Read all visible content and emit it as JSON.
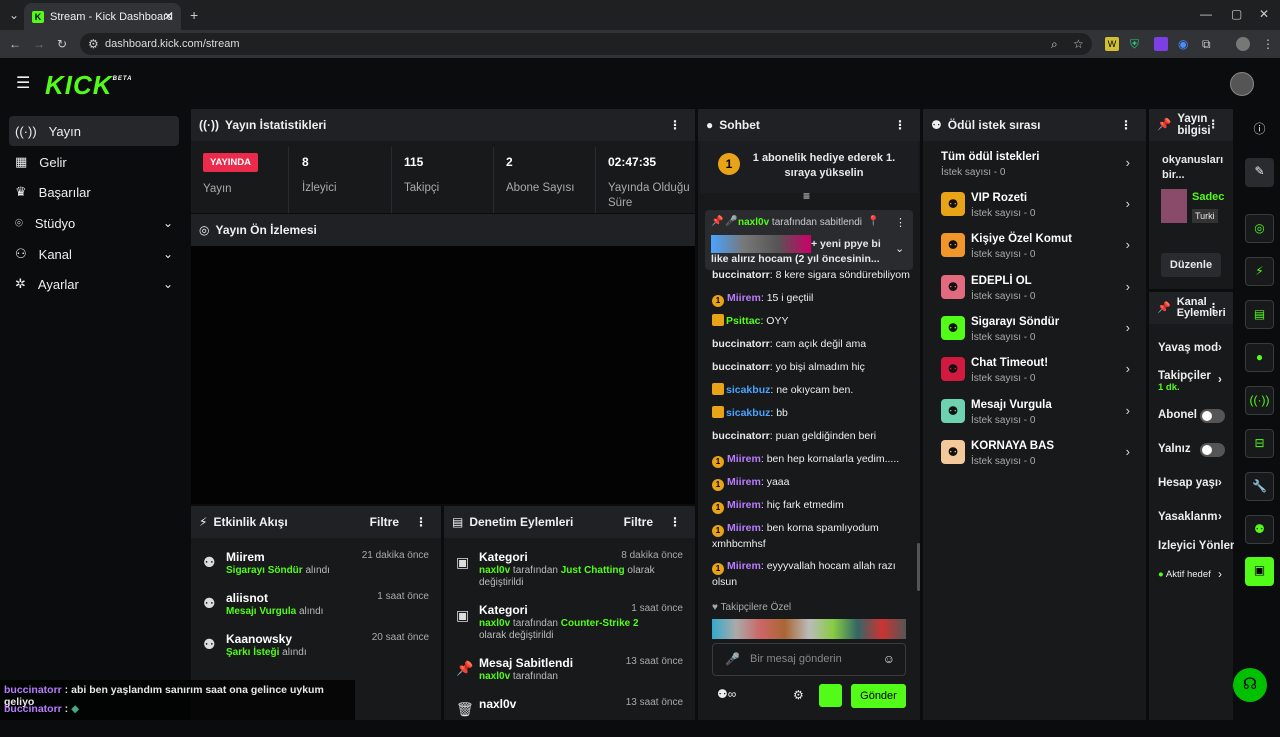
{
  "browser": {
    "tab_title": "Stream - Kick Dashboard",
    "url": "dashboard.kick.com/stream"
  },
  "brand": {
    "logo": "KICK",
    "logo_sup": "BETA"
  },
  "nav": [
    {
      "label": "Yayın",
      "icon": "broadcast-icon"
    },
    {
      "label": "Gelir",
      "icon": "chart-icon"
    },
    {
      "label": "Başarılar",
      "icon": "trophy-icon"
    },
    {
      "label": "Stüdyo",
      "icon": "studio-icon"
    },
    {
      "label": "Kanal",
      "icon": "users-icon"
    },
    {
      "label": "Ayarlar",
      "icon": "gear-icon"
    }
  ],
  "stats": {
    "title": "Yayın İstatistikleri",
    "live": "YAYINDA",
    "live_label": "Yayın",
    "items": [
      {
        "value": "8",
        "label": "İzleyici"
      },
      {
        "value": "115",
        "label": "Takipçi"
      },
      {
        "value": "2",
        "label": "Abone Sayısı"
      },
      {
        "value": "02:47:35",
        "label": "Yayında Olduğu Süre"
      }
    ]
  },
  "preview": {
    "title": "Yayın Ön İzlemesi"
  },
  "activity": {
    "title": "Etkinlik Akışı",
    "filter": "Filtre",
    "items": [
      {
        "name": "Miirem",
        "reward": "Sigarayı Söndür",
        "suffix": "alındı",
        "time": "21 dakika önce"
      },
      {
        "name": "aliisnot",
        "reward": "Mesajı Vurgula",
        "suffix": "alındı",
        "time": "1 saat önce"
      },
      {
        "name": "Kaanowsky",
        "reward": "Şarkı İsteği",
        "suffix": "alındı",
        "time": "20 saat önce"
      }
    ]
  },
  "moderation": {
    "title": "Denetim Eylemleri",
    "filter": "Filtre",
    "items": [
      {
        "name": "Kategori",
        "user": "naxl0v",
        "mid": "tarafından",
        "value": "Just Chatting",
        "end": "olarak değiştirildi",
        "time": "8 dakika önce"
      },
      {
        "name": "Kategori",
        "user": "naxl0v",
        "mid": "tarafından",
        "value": "Counter-Strike 2",
        "end": "olarak değiştirildi",
        "time": "1 saat önce"
      },
      {
        "name": "Mesaj Sabitlendi",
        "user": "naxl0v",
        "mid": "tarafından",
        "value": "",
        "end": "",
        "time": "13 saat önce"
      },
      {
        "name": "naxl0v",
        "user": "",
        "mid": "",
        "value": "",
        "end": "",
        "time": "13 saat önce"
      }
    ]
  },
  "chat": {
    "title": "Sohbet",
    "promo": "1 abonelik hediye ederek 1. sıraya yükselin",
    "promo_num": "1",
    "pinned_user": "naxl0v",
    "pinned_by": "tarafından sabitlendi",
    "pinned_text": "+ yeni ppye bi like alırız hocam (2 yıl öncesinin...",
    "messages": [
      {
        "user": "buccinatorr",
        "cls": "u-w",
        "text": "8 kere sigara söndürebiliyom",
        "coin": false
      },
      {
        "user": "Miirem",
        "cls": "u-p",
        "text": "15 i geçtiil",
        "coin": true
      },
      {
        "user": "Psittac",
        "cls": "u-g",
        "text": "OYY",
        "coin": false
      },
      {
        "user": "buccinatorr",
        "cls": "u-w",
        "text": "cam açık değil ama",
        "coin": false
      },
      {
        "user": "buccinatorr",
        "cls": "u-w",
        "text": "yo bişi almadım hiç",
        "coin": false
      },
      {
        "user": "sicakbuz",
        "cls": "u-b",
        "text": "ne okıycam ben.",
        "coin": false
      },
      {
        "user": "sicakbuz",
        "cls": "u-b",
        "text": "bb",
        "coin": false
      },
      {
        "user": "buccinatorr",
        "cls": "u-w",
        "text": "puan geldiğinden beri",
        "coin": false
      },
      {
        "user": "Miirem",
        "cls": "u-p",
        "text": "ben hep kornalarla yedim.....",
        "coin": true
      },
      {
        "user": "Miirem",
        "cls": "u-p",
        "text": "yaaa",
        "coin": true
      },
      {
        "user": "Miirem",
        "cls": "u-p",
        "text": "hiç fark etmedim",
        "coin": true
      },
      {
        "user": "Miirem",
        "cls": "u-p",
        "text": "ben korna spamlıyodum xmhbcmhsf",
        "coin": true
      },
      {
        "user": "Miirem",
        "cls": "u-p",
        "text": "eyyyvallah hocam allah razı olsun",
        "coin": true
      }
    ],
    "followers_only": "Takipçilere Özel",
    "placeholder": "Bir mesaj gönderin",
    "send": "Gönder"
  },
  "rewards": {
    "title": "Ödül istek sırası",
    "all": "Tüm ödül istekleri",
    "all_sub": "İstek sayısı - 0",
    "items": [
      {
        "name": "VIP Rozeti",
        "sub": "İstek sayısı - 0",
        "color": "#e8a317"
      },
      {
        "name": "Kişiye Özel Komut",
        "sub": "İstek sayısı - 0",
        "color": "#f0962a"
      },
      {
        "name": "EDEPLİ OL",
        "sub": "İstek sayısı - 0",
        "color": "#e26a7e"
      },
      {
        "name": "Sigarayı Söndür",
        "sub": "İstek sayısı - 0",
        "color": "#53fc18"
      },
      {
        "name": "Chat Timeout!",
        "sub": "İstek sayısı - 0",
        "color": "#d11a40"
      },
      {
        "name": "Mesajı Vurgula",
        "sub": "İstek sayısı - 0",
        "color": "#6ed1b0"
      },
      {
        "name": "KORNAYA BAS",
        "sub": "İstek sayısı - 0",
        "color": "#f3c89a"
      }
    ]
  },
  "stream_info": {
    "title": "Yayın bilgisi",
    "text": "okyanusları bir...",
    "category": "Sadec",
    "lang": "Turki",
    "edit": "Düzenle"
  },
  "channel_actions": {
    "title": "Kanal Eylemleri",
    "items": [
      {
        "label": "Yavaş mod",
        "kind": "arrow"
      },
      {
        "label": "Takipçiler",
        "sub": "1 dk.",
        "kind": "arrow"
      },
      {
        "label": "Abonel",
        "kind": "toggle"
      },
      {
        "label": "Yalnız",
        "kind": "toggle"
      },
      {
        "label": "Hesap yaşı",
        "kind": "arrow"
      },
      {
        "label": "Yasaklanm",
        "kind": "arrow"
      },
      {
        "label": "İzleyici Yönlend",
        "kind": "none"
      },
      {
        "label": "Aktif hedef",
        "kind": "arrow"
      }
    ]
  },
  "overlay": [
    {
      "user": "buccinatorr",
      "text": "abi ben yaşlandım sanırım saat ona gelince uykum geliyo"
    },
    {
      "user": "buccinatorr",
      "text": ""
    }
  ]
}
